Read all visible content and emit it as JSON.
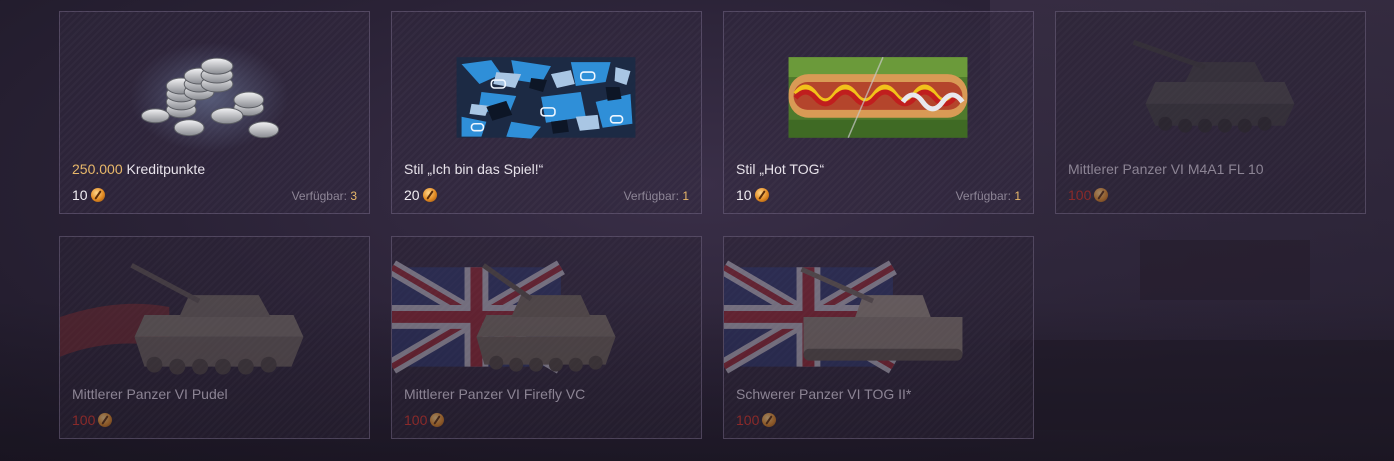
{
  "cards": [
    {
      "amount": "250.000",
      "title": "Kreditpunkte",
      "price": "10",
      "avail_label": "Verfügbar:",
      "avail_value": "3"
    },
    {
      "title": "Stil „Ich bin das Spiel!“",
      "price": "20",
      "avail_label": "Verfügbar:",
      "avail_value": "1"
    },
    {
      "title": "Stil „Hot TOG“",
      "price": "10",
      "avail_label": "Verfügbar:",
      "avail_value": "1"
    },
    {
      "class_label": "Mittlerer Panzer",
      "tier": "VI",
      "name": "M4A1 FL 10",
      "price": "100"
    },
    {
      "class_label": "Mittlerer Panzer",
      "tier": "VI",
      "name": "Pudel",
      "price": "100"
    },
    {
      "class_label": "Mittlerer Panzer",
      "tier": "VI",
      "name": "Firefly VC",
      "price": "100"
    },
    {
      "class_label": "Schwerer Panzer",
      "tier": "VI",
      "name": "TOG II*",
      "price": "100"
    }
  ],
  "icons": {
    "currency": "bond-coin-icon"
  },
  "colors": {
    "amount": "#e7b76a",
    "unavailable_price": "#8a2a2a",
    "text": "#e7e2ea"
  }
}
